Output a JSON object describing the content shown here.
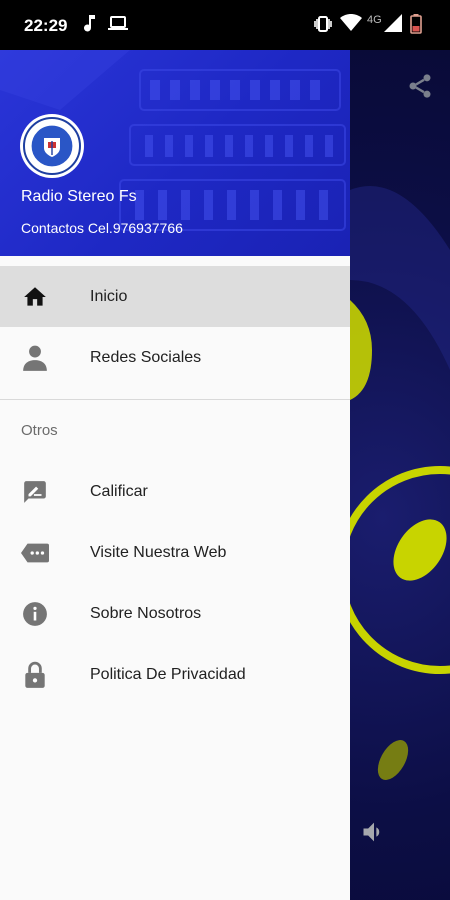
{
  "status_bar": {
    "time": "22:29",
    "network": "4G",
    "icons": [
      "music-note-icon",
      "laptop-icon",
      "vibrate-icon",
      "wifi-icon",
      "cell-signal-icon",
      "battery-icon"
    ]
  },
  "drawer": {
    "header": {
      "station_name": "Radio Stereo Fs",
      "contact": "Contactos Cel.976937766"
    },
    "main_items": [
      {
        "label": "Inicio",
        "icon": "home-icon",
        "active": true
      },
      {
        "label": "Redes Sociales",
        "icon": "person-icon",
        "active": false
      }
    ],
    "section_title": "Otros",
    "other_items": [
      {
        "label": "Calificar",
        "icon": "rate-review-icon"
      },
      {
        "label": "Visite Nuestra Web",
        "icon": "web-icon"
      },
      {
        "label": "Sobre Nosotros",
        "icon": "info-icon"
      },
      {
        "label": "Politica De Privacidad",
        "icon": "lock-icon"
      }
    ]
  },
  "background_app": {
    "icons": [
      "share-icon",
      "volume-icon"
    ]
  },
  "colors": {
    "header_blue": "#1e28c4",
    "active_item_bg": "#dddddd",
    "accent_yellow": "#c8d400"
  }
}
